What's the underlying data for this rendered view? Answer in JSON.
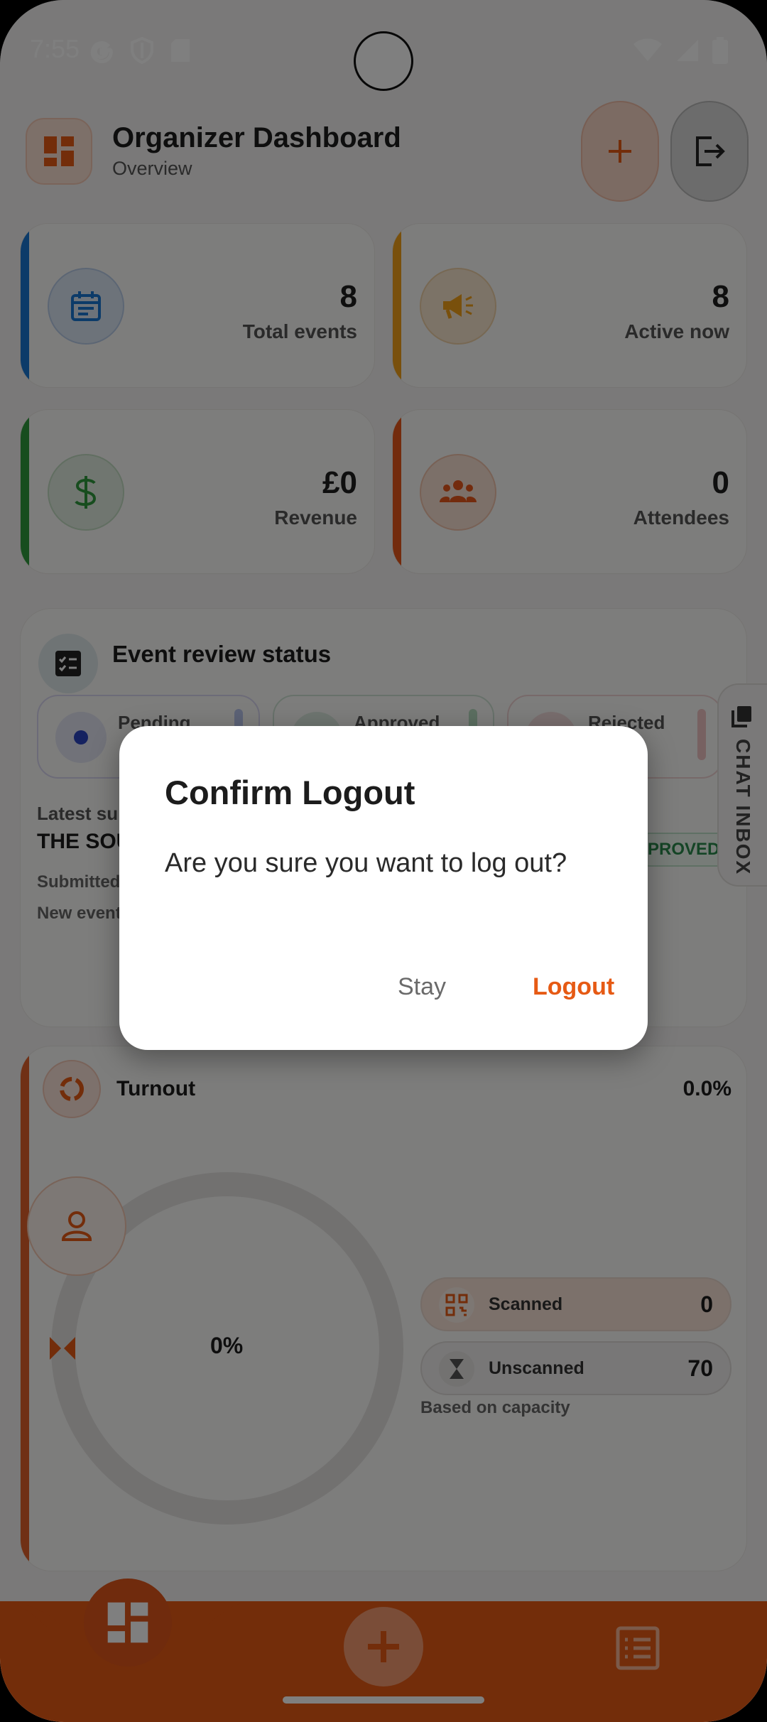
{
  "status": {
    "time": "7:55"
  },
  "header": {
    "title": "Organizer Dashboard",
    "subtitle": "Overview"
  },
  "stats": [
    {
      "value": "8",
      "label": "Total events",
      "accent": "#1976d2"
    },
    {
      "value": "8",
      "label": "Active now",
      "accent": "#f2a019"
    },
    {
      "value": "£0",
      "label": "Revenue",
      "accent": "#2e9a3c"
    },
    {
      "value": "0",
      "label": "Attendees",
      "accent": "#e6571a"
    }
  ],
  "review": {
    "title": "Event review status",
    "tabs": [
      "Pending",
      "Approved",
      "Rejected"
    ],
    "latest_label": "Latest su",
    "latest_title": "THE SOU",
    "submitted": "Submitted",
    "new_event": "New event",
    "badge": "PROVED"
  },
  "chat": {
    "label": "CHAT INBOX"
  },
  "turnout": {
    "title": "Turnout",
    "percent": "0.0%",
    "ring_label": "0%",
    "scanned_label": "Scanned",
    "scanned_value": "0",
    "unscanned_label": "Unscanned",
    "unscanned_value": "70",
    "note": "Based on capacity",
    "progress": 0.0
  },
  "dialog": {
    "title": "Confirm Logout",
    "body": "Are you sure you want to log out?",
    "stay": "Stay",
    "logout": "Logout"
  },
  "colors": {
    "brand": "#e65a14",
    "scrim": "rgba(0,0,0,0.5)"
  }
}
